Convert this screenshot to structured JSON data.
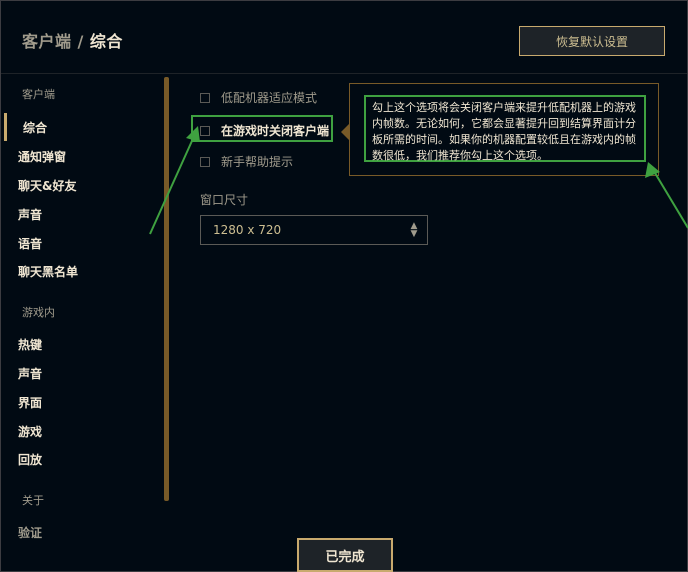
{
  "header": {
    "section": "客户端",
    "separator": "/",
    "current": "综合",
    "reset_button": "恢复默认设置"
  },
  "sidebar": {
    "groups": [
      {
        "label": "客户端",
        "items": [
          "综合",
          "通知弹窗",
          "聊天&好友",
          "声音",
          "语音",
          "聊天黑名单"
        ]
      },
      {
        "label": "游戏内",
        "items": [
          "热键",
          "声音",
          "界面",
          "游戏",
          "回放"
        ]
      },
      {
        "label": "关于",
        "items": [
          "验证"
        ]
      }
    ]
  },
  "options": {
    "low_spec": "低配机器适应模式",
    "close_client": "在游戏时关闭客户端",
    "newbie_tips": "新手帮助提示"
  },
  "tooltip": {
    "text": "勾上这个选项将会关闭客户端来提升低配机器上的游戏内帧数。无论如何，它都会显著提升回到结算界面计分板所需的时间。如果你的机器配置较低且在游戏内的帧数很低，我们推荐你勾上这个选项。"
  },
  "window_size": {
    "label": "窗口尺寸",
    "value": "1280 x 720"
  },
  "footer": {
    "done_button": "已完成"
  },
  "colors": {
    "gold": "#c8aa6e",
    "highlight_green": "#3fa140",
    "background": "#010a13"
  }
}
